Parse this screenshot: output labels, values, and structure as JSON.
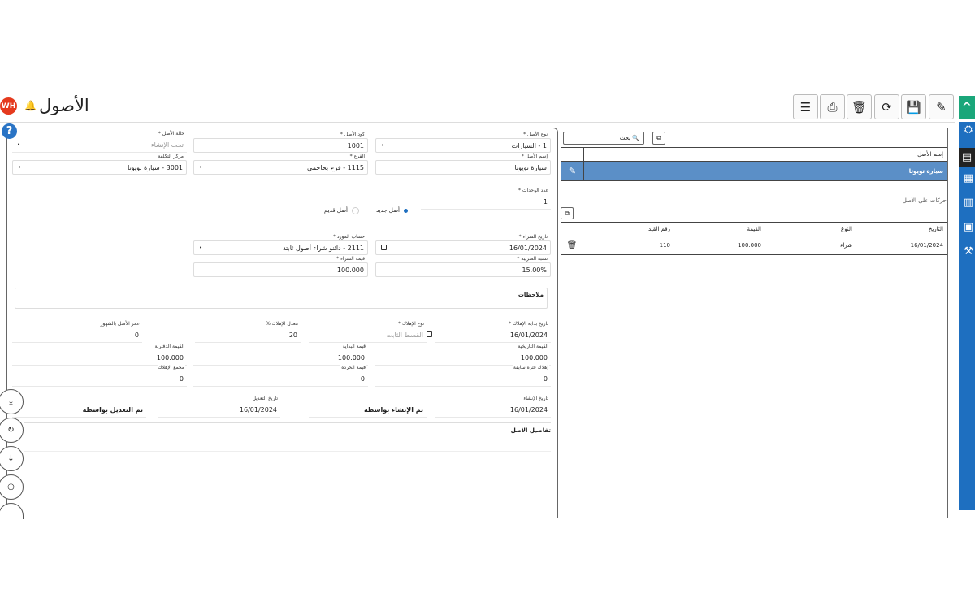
{
  "header": {
    "title": "الأصول",
    "logo_text": "WH",
    "bell_icon": "bell-icon"
  },
  "toolbar": [
    {
      "name": "list-button",
      "icon": "list-icon",
      "glyph": "☰"
    },
    {
      "name": "print-button",
      "icon": "printer-icon",
      "glyph": "⎙"
    },
    {
      "name": "delete-button",
      "icon": "trash-icon",
      "glyph": "🗑"
    },
    {
      "name": "refresh-button",
      "icon": "refresh-icon",
      "glyph": "⟳"
    },
    {
      "name": "save-button",
      "icon": "save-icon",
      "glyph": "💾"
    },
    {
      "name": "edit-button",
      "icon": "pencil-icon",
      "glyph": "✎"
    }
  ],
  "form": {
    "fields": [
      {
        "label": "نوع الأصل *",
        "value": "1 - السيارات",
        "type": "select"
      },
      {
        "label": "كود الأصل *",
        "value": "1001"
      },
      {
        "label": "حالة الأصل *",
        "value": "تحت الإنشاء",
        "type": "select",
        "muted": true
      },
      {
        "label": "إسم الأصل *",
        "value": "سيارة تويوتا"
      },
      {
        "label": "الفرع *",
        "value": "1115 - فرع بحاجمي",
        "type": "select"
      },
      {
        "label": "مركز التكلفة",
        "value": "3001 - سيارة تويوتا",
        "type": "select"
      },
      {
        "label": "عدد الوحدات *",
        "value": "1"
      },
      {
        "label": "تاريخ الشراء *",
        "value": "16/01/2024",
        "type": "date"
      },
      {
        "label": "حساب المورد *",
        "value": "2111 - دائنو شراء أصول ثابتة",
        "type": "select"
      },
      {
        "label": "نسبة الضريبة *",
        "value": "15.00%"
      },
      {
        "label": "قيمة الشراء *",
        "value": "100.000"
      },
      {
        "label": "تاريخ بداية الإهلاك *",
        "value": "16/01/2024",
        "type": "date"
      },
      {
        "label": "نوع الإهلاك *",
        "value": "القسط الثابت",
        "muted": true
      },
      {
        "label": "معدل الإهلاك %",
        "value": "20"
      },
      {
        "label": "عمر الأصل بالشهور",
        "value": "0"
      },
      {
        "label": "القيمة التاريخية",
        "value": "100.000"
      },
      {
        "label": "قيمة البداية",
        "value": "100.000"
      },
      {
        "label": "القيمة الدفترية",
        "value": "100.000"
      },
      {
        "label": "إهلاك فترة سابقة",
        "value": "0"
      },
      {
        "label": "قيمة الخردة",
        "value": "0"
      },
      {
        "label": "مجمع الإهلاك",
        "value": "0"
      },
      {
        "label": "تاريخ الإنشاء",
        "value": "16/01/2024"
      },
      {
        "label": "",
        "value": "تم الإنشاء بواسطة"
      },
      {
        "label": "تاريخ التعديل",
        "value": "16/01/2024"
      },
      {
        "label": "",
        "value": "تم التعديل بواسطة"
      }
    ],
    "radio": {
      "new_label": "أصل جديد",
      "old_label": "أصل قديم",
      "selected": "new"
    },
    "notes_label": "ملاحظات",
    "details_label": "تفاصيل الأصل"
  },
  "list": {
    "search_placeholder": "بحث",
    "column": "إسم الأصل",
    "rows": [
      "سيارة تويوتا"
    ],
    "selected_color": "#5b8fc7"
  },
  "movements": {
    "title": "حركات على الأصل",
    "columns": [
      "التاريخ",
      "النوع",
      "القيمة",
      "رقم القيد"
    ],
    "rows": [
      [
        "16/01/2024",
        "شراء",
        "100.000",
        "110"
      ]
    ]
  },
  "sidebar": {
    "color": "#1e6fc0",
    "icons": [
      "assets-icon",
      "asset-card-icon",
      "grid-icon",
      "table-icon",
      "building-icon",
      "tools-icon"
    ],
    "active": 1
  }
}
